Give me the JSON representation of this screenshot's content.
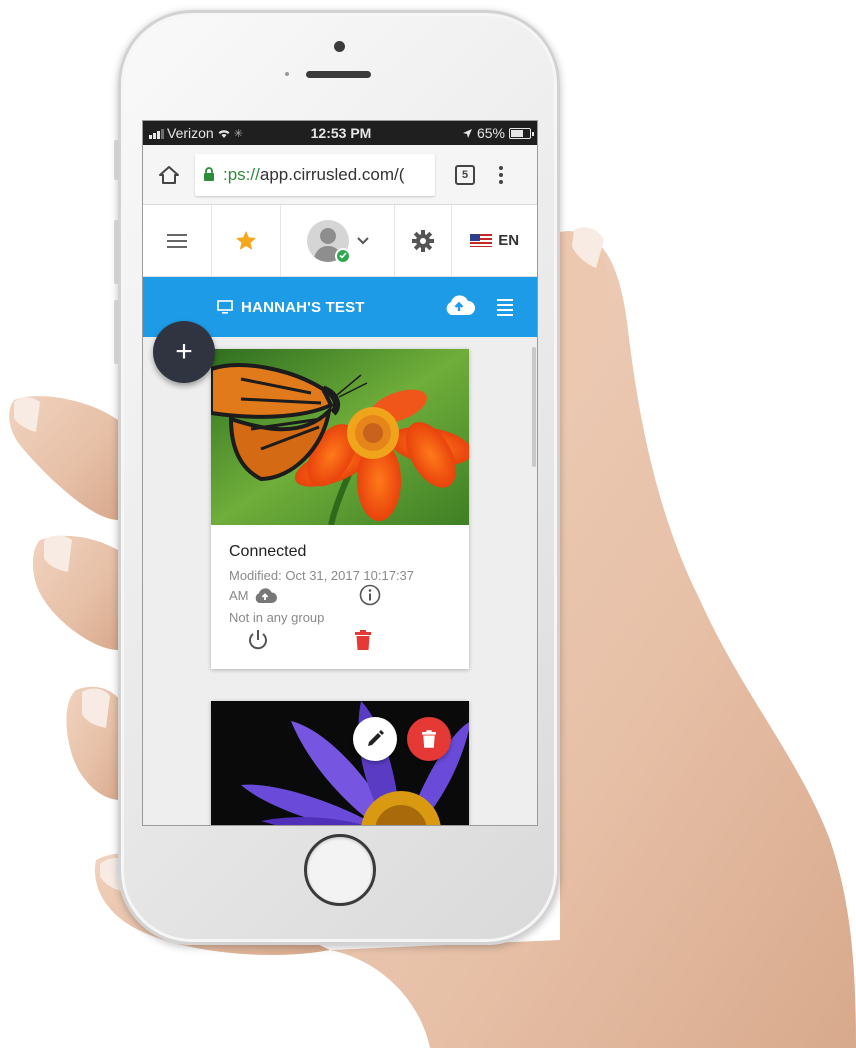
{
  "statusbar": {
    "carrier": "Verizon",
    "time": "12:53 PM",
    "battery_text": "65%",
    "battery_level": 0.65
  },
  "browser": {
    "url_prefix": ":ps://",
    "url_rest": "app.cirrusled.com/(",
    "tab_count": "5"
  },
  "toolbar": {
    "language_label": "EN",
    "accent_star": "#f4a81d"
  },
  "header": {
    "title": "HANNAH'S TEST",
    "color": "#1e9be6"
  },
  "fab": {
    "label": "+"
  },
  "cards": [
    {
      "status": "Connected",
      "modified": "Modified: Oct 31, 2017 10:17:37",
      "modified_suffix": "AM",
      "group": "Not in any group",
      "image": "butterfly-on-orange-flower"
    },
    {
      "image": "purple-water-lily"
    }
  ],
  "colors": {
    "danger": "#e53935",
    "fab": "#2f3440"
  }
}
